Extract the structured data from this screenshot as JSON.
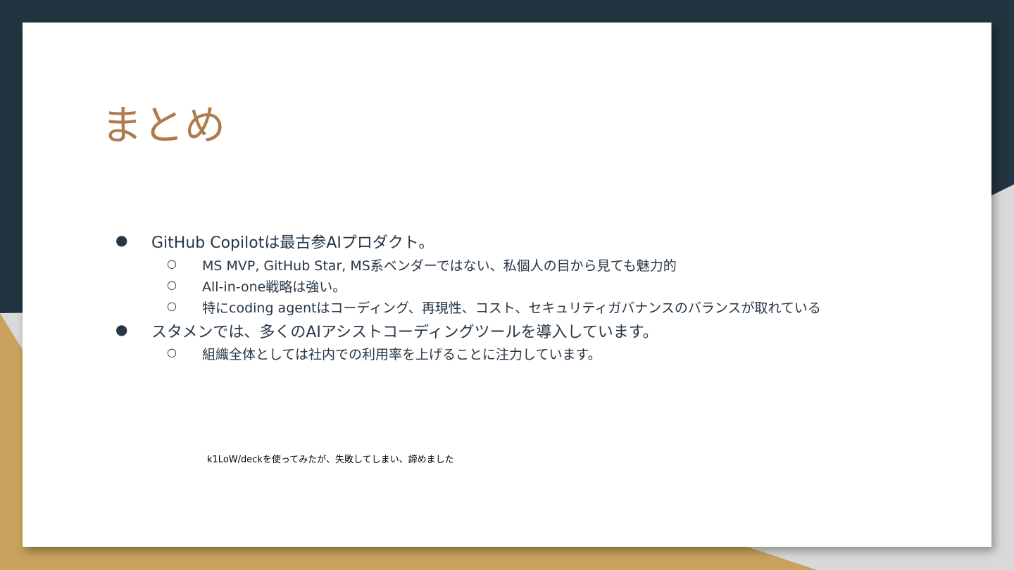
{
  "slide": {
    "title": "まとめ",
    "bullets": [
      {
        "text": "GitHub Copilotは最古参AIプロダクト。",
        "sub": [
          "MS MVP, GitHub Star, MS系ベンダーではない、私個人の目から見ても魅力的",
          "All-in-one戦略は強い。",
          "特にcoding agentはコーディング、再現性、コスト、セキュリティガバナンスのバランスが取れている"
        ]
      },
      {
        "text": "スタメンでは、多くのAIアシストコーディングツールを導入しています。",
        "sub": [
          "組織全体としては社内での利用率を上げることに注力しています。"
        ]
      }
    ],
    "footnote": "k1LoW/deckを使ってみたが、失敗してしまい、諦めました"
  },
  "symbols": {
    "filled_bullet": "●",
    "hollow_bullet": "○"
  },
  "colors": {
    "title": "#b07b4c",
    "text": "#263645",
    "navy_band": "#22343f",
    "gold_band": "#c9a35e",
    "slide_bg": "#ffffff"
  }
}
